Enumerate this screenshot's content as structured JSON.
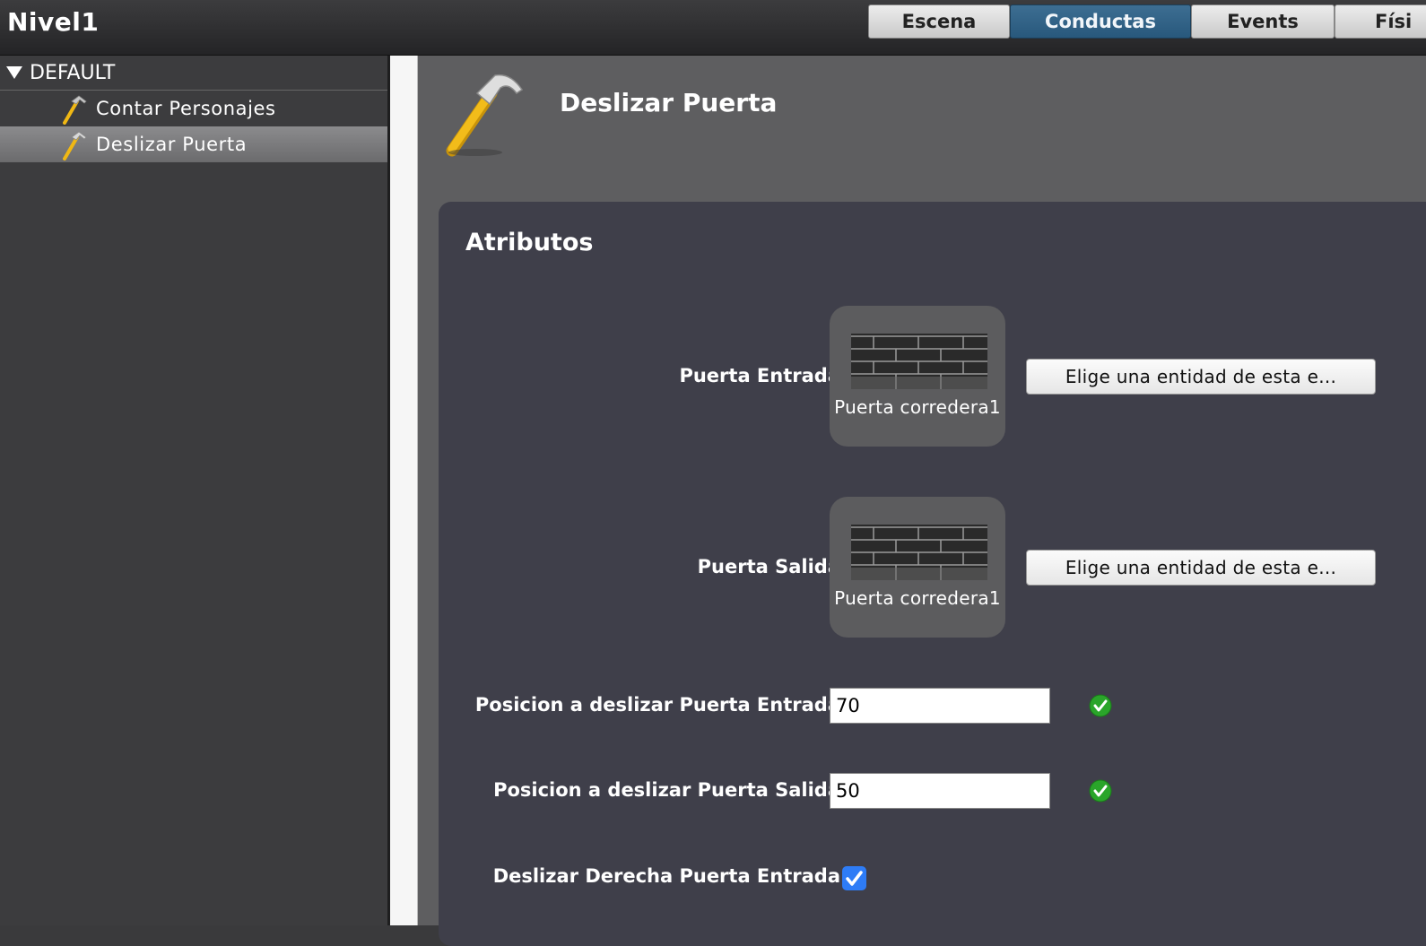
{
  "app": {
    "title": "Nivel1"
  },
  "tabs": [
    {
      "label": "Escena",
      "active": false
    },
    {
      "label": "Conductas",
      "active": true
    },
    {
      "label": "Events",
      "active": false
    },
    {
      "label": "Físi",
      "active": false
    }
  ],
  "sidebar": {
    "group": "DEFAULT",
    "items": [
      {
        "label": "Contar Personajes",
        "icon": "hammer-icon",
        "selected": false
      },
      {
        "label": "Deslizar Puerta",
        "icon": "hammer-icon",
        "selected": true
      }
    ]
  },
  "main": {
    "title": "Deslizar Puerta",
    "icon": "hammer-icon",
    "panel_title": "Atributos",
    "attributes": [
      {
        "label": "Puerta Entrada",
        "entity": "Puerta corredera1",
        "button": "Elige una entidad de esta e..."
      },
      {
        "label": "Puerta Salida",
        "entity": "Puerta corredera1",
        "button": "Elige una entidad de esta e..."
      },
      {
        "label": "Posicion a deslizar Puerta Entrada",
        "value": "70",
        "valid": true
      },
      {
        "label": "Posicion a deslizar Puerta Salida",
        "value": "50",
        "valid": true
      },
      {
        "label": "Deslizar Derecha Puerta Entrada",
        "checked": true
      }
    ]
  },
  "colors": {
    "active_tab": "#2f5f84",
    "selected_item": "#7a7a7c",
    "panel": "#3f3f4a",
    "checkbox": "#2e7cf6",
    "valid": "#2aa52a"
  }
}
